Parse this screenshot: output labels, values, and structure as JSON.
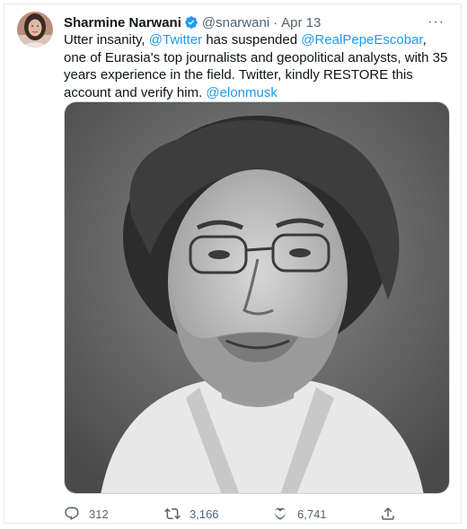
{
  "tweet": {
    "author_name": "Sharmine Narwani",
    "author_handle": "@snarwani",
    "separator": "·",
    "date": "Apr 13",
    "more_label": "···",
    "text": {
      "t1": "Utter insanity, ",
      "m1": "@Twitter",
      "t2": " has suspended ",
      "m2": "@RealPepeEscobar",
      "t3": ", one of Eurasia's top journalists and geopolitical analysts, with 35 years experience in the field. Twitter, kindly RESTORE this account and verify him. ",
      "m3": "@elonmusk"
    },
    "media_description": "black-and-white-portrait-photo",
    "actions": {
      "replies": "312",
      "retweets": "3,166",
      "likes": "6,741"
    }
  },
  "colors": {
    "accent": "#1d9bf0",
    "text": "#0f1419",
    "muted": "#536471",
    "border": "#e6ecf0"
  },
  "icons": [
    "verified-badge-icon",
    "more-icon",
    "reply-icon",
    "retweet-icon",
    "like-icon",
    "share-icon"
  ]
}
